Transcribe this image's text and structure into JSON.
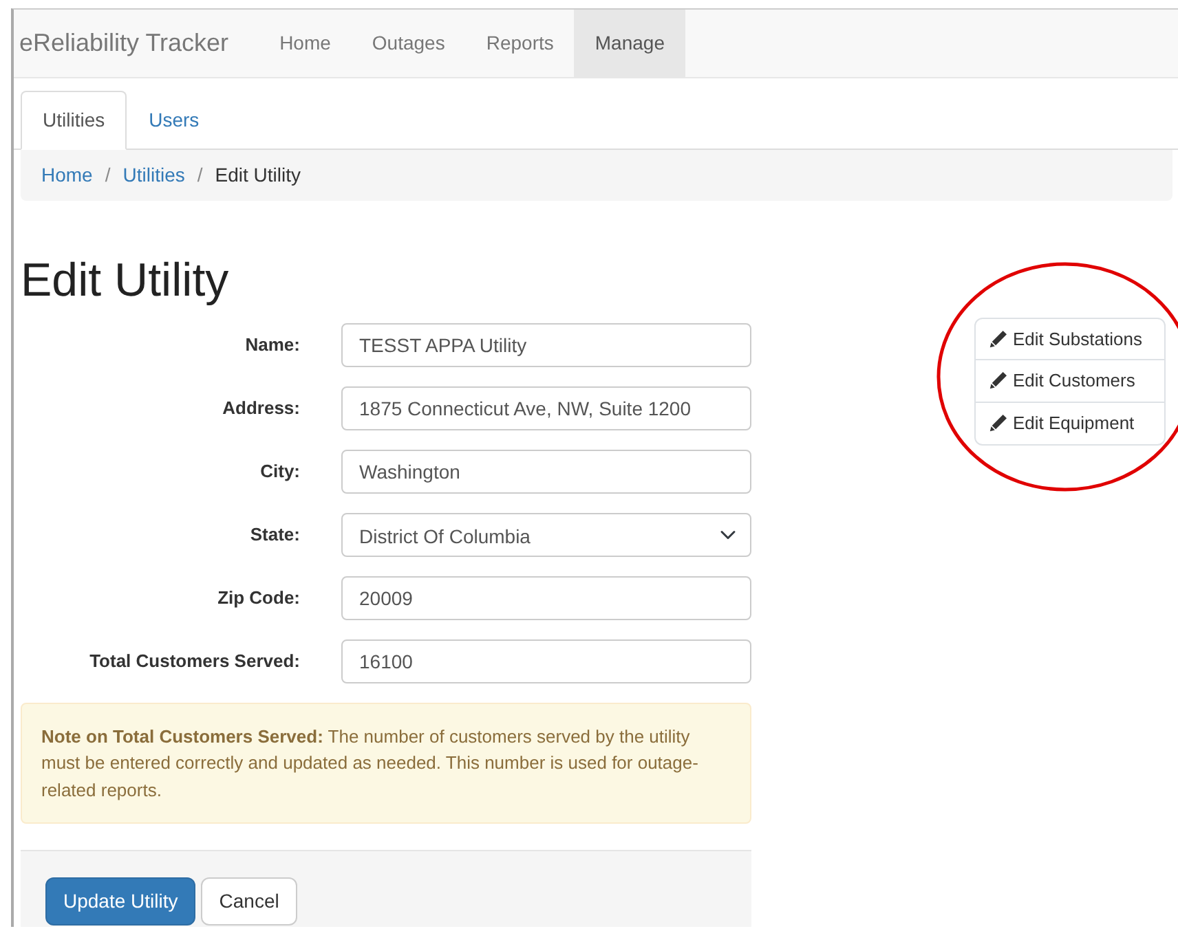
{
  "brand": "eReliability Tracker",
  "nav": [
    {
      "label": "Home",
      "selected": false
    },
    {
      "label": "Outages",
      "selected": false
    },
    {
      "label": "Reports",
      "selected": false
    },
    {
      "label": "Manage",
      "selected": true
    }
  ],
  "tabs": [
    {
      "label": "Utilities",
      "selected": true
    },
    {
      "label": "Users",
      "selected": false
    }
  ],
  "breadcrumb": [
    {
      "label": "Home",
      "kind": "link"
    },
    {
      "label": "Utilities",
      "kind": "link"
    },
    {
      "label": "Edit Utility",
      "kind": "current"
    }
  ],
  "breadcrumb_separator": "/",
  "heading": "Edit Utility",
  "fields": [
    {
      "label": "Name:",
      "kind": "text",
      "value": "TESST APPA Utility"
    },
    {
      "label": "Address:",
      "kind": "text",
      "value": "1875 Connecticut Ave, NW, Suite 1200"
    },
    {
      "label": "City:",
      "kind": "text",
      "value": "Washington"
    },
    {
      "label": "State:",
      "kind": "select",
      "value": "District Of Columbia"
    },
    {
      "label": "Zip Code:",
      "kind": "text",
      "value": "20009"
    },
    {
      "label": "Total Customers Served:",
      "kind": "text",
      "value": "16100"
    }
  ],
  "note": "**Note on Total Customers Served:** The number of customers served by the utility must be entered correctly and updated as needed. This number is used for outage-related reports.",
  "actions": [
    {
      "label": "Update Utility",
      "kind": "primary"
    },
    {
      "label": "Cancel",
      "kind": "default"
    }
  ],
  "side_links": [
    {
      "label": "Edit Substations"
    },
    {
      "label": "Edit Customers"
    },
    {
      "label": "Edit Equipment"
    }
  ]
}
